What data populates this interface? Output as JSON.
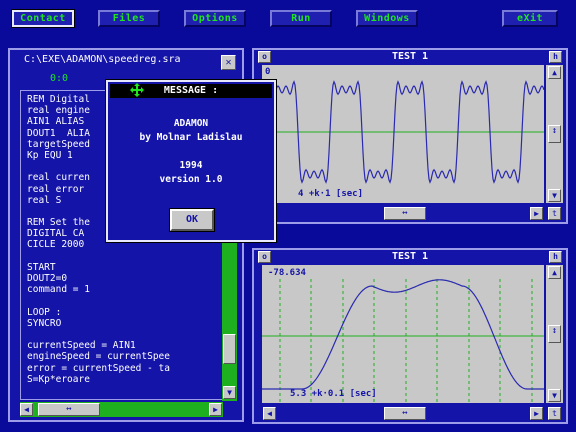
{
  "menu": {
    "items": [
      {
        "label": "Contact"
      },
      {
        "label": "Files"
      },
      {
        "label": "Options"
      },
      {
        "label": "Run"
      },
      {
        "label": "Windows"
      },
      {
        "label": "eXit"
      }
    ]
  },
  "editor": {
    "title": "C:\\EXE\\ADAMON\\speedreg.sra",
    "close_glyph": "✕",
    "position": "0:0",
    "lines": [
      "REM Digital",
      "real engine",
      "AIN1 ALIAS",
      "DOUT1  ALIA",
      "targetSpeed",
      "Kp EQU 1",
      "",
      "real curren",
      "real error",
      "real S",
      "",
      "REM Set the",
      "DIGITAL CA",
      "CICLE 2000",
      "",
      "START",
      "DOUT2=0",
      "command = 1",
      "",
      "LOOP :",
      "SYNCRO",
      "",
      "currentSpeed = AIN1",
      "engineSpeed = currentSpee",
      "error = currentSpeed - ta",
      "S=Kp*eroare"
    ],
    "scroll_up": "▲",
    "scroll_down": "▼",
    "scroll_left": "◀",
    "scroll_right": "▶",
    "h_thumb": "↔"
  },
  "dialog": {
    "title": "MESSAGE :",
    "lines": [
      "ADAMON",
      "by Molnar Ladislau",
      "",
      "1994",
      "version 1.0"
    ],
    "ok_label": "OK"
  },
  "plot1": {
    "title": "TEST 1",
    "left_ctrl": "o",
    "right_ctrl": "h",
    "readout": "0",
    "axis_caption": "4  +k·1  [sec]",
    "h_thumb": "↔",
    "scroll_left": "◀",
    "scroll_right": "▶",
    "t_button": "t",
    "scroll_up": "▲",
    "scroll_down": "▼",
    "v_thumb": "↕"
  },
  "plot2": {
    "title": "TEST 1",
    "left_ctrl": "o",
    "right_ctrl": "h",
    "readout": "-78.634",
    "axis_caption": "5.3  +k·0.1  [sec]",
    "h_thumb": "↔",
    "scroll_left": "◀",
    "scroll_right": "▶",
    "t_button": "t",
    "scroll_up": "▲",
    "scroll_down": "▼",
    "v_thumb": "↕"
  },
  "colors": {
    "background": "#0a0a9a",
    "menu_text": "#1fe61f",
    "plot_bg": "#c8c8c8",
    "trace": "#2a2ab0",
    "grid": "#1fb01f"
  },
  "icons": {
    "dialog_move": "move-arrows-icon"
  }
}
